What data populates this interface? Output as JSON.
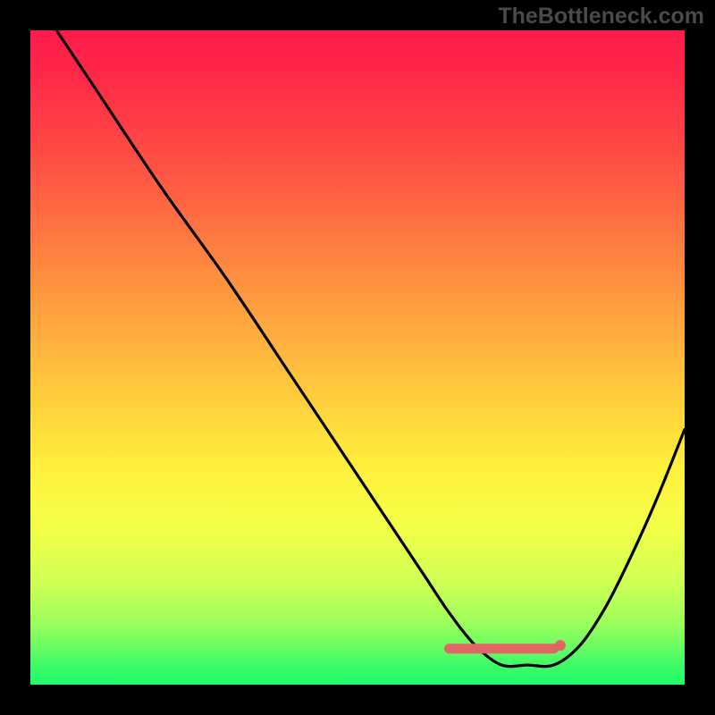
{
  "watermark": "TheBottleneck.com",
  "chart_data": {
    "type": "line",
    "title": "",
    "xlabel": "",
    "ylabel": "",
    "xlim": [
      0,
      100
    ],
    "ylim": [
      0,
      100
    ],
    "series": [
      {
        "name": "curve",
        "x": [
          4,
          10,
          20,
          30,
          40,
          50,
          60,
          64,
          68,
          72,
          76,
          80,
          84,
          88,
          92,
          96,
          100
        ],
        "values": [
          100,
          91,
          76,
          62,
          47,
          32,
          17,
          11,
          6,
          3,
          3,
          3,
          6,
          12,
          20,
          29,
          39
        ]
      },
      {
        "name": "highlight-flat",
        "x": [
          64,
          80
        ],
        "values": [
          5.5,
          5.5
        ]
      },
      {
        "name": "highlight-dot",
        "x": [
          81
        ],
        "values": [
          6
        ]
      }
    ],
    "gradient_stops": [
      {
        "offset": 0.0,
        "color": "#ff1b4a"
      },
      {
        "offset": 0.06,
        "color": "#ff2648"
      },
      {
        "offset": 0.18,
        "color": "#ff4844"
      },
      {
        "offset": 0.32,
        "color": "#ff7a41"
      },
      {
        "offset": 0.46,
        "color": "#ffab3e"
      },
      {
        "offset": 0.58,
        "color": "#ffd43c"
      },
      {
        "offset": 0.68,
        "color": "#fff23d"
      },
      {
        "offset": 0.76,
        "color": "#f3ff47"
      },
      {
        "offset": 0.84,
        "color": "#d1ff53"
      },
      {
        "offset": 0.905,
        "color": "#9dff5c"
      },
      {
        "offset": 0.94,
        "color": "#6dfc62"
      },
      {
        "offset": 0.97,
        "color": "#3efb68"
      },
      {
        "offset": 1.0,
        "color": "#1dfc6a"
      }
    ]
  },
  "colors": {
    "background": "#000000",
    "curve": "#000000",
    "highlight": "#e06666",
    "watermark": "#4a4a4a"
  }
}
